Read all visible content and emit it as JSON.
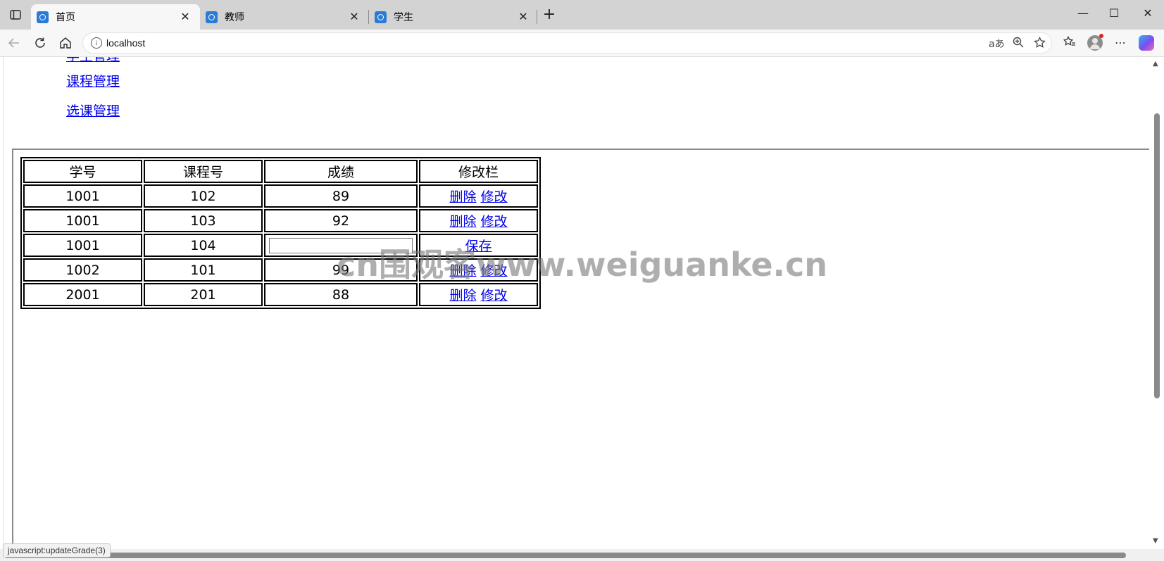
{
  "browser": {
    "tabs": [
      {
        "title": "首页",
        "active": true
      },
      {
        "title": "教师",
        "active": false
      },
      {
        "title": "学生",
        "active": false
      }
    ],
    "url": "localhost",
    "status_text": "javascript:updateGrade(3)"
  },
  "page": {
    "nav_links": [
      {
        "label": "课程管理"
      },
      {
        "label": "选课管理"
      }
    ],
    "table": {
      "headers": [
        "学号",
        "课程号",
        "成绩",
        "修改栏"
      ],
      "rows": [
        {
          "student_id": "1001",
          "course_id": "102",
          "grade": "89",
          "editing": false
        },
        {
          "student_id": "1001",
          "course_id": "103",
          "grade": "92",
          "editing": false
        },
        {
          "student_id": "1001",
          "course_id": "104",
          "grade": "",
          "editing": true
        },
        {
          "student_id": "1002",
          "course_id": "101",
          "grade": "99",
          "editing": false
        },
        {
          "student_id": "2001",
          "course_id": "201",
          "grade": "88",
          "editing": false
        }
      ],
      "delete_label": "删除",
      "edit_label": "修改",
      "save_label": "保存"
    }
  },
  "watermark": "cn围观客www.weiguanke.cn",
  "colors": {
    "link": "#0000ee",
    "tabbar_bg": "#d3d3d3",
    "favicon": "#2a7bd4"
  }
}
